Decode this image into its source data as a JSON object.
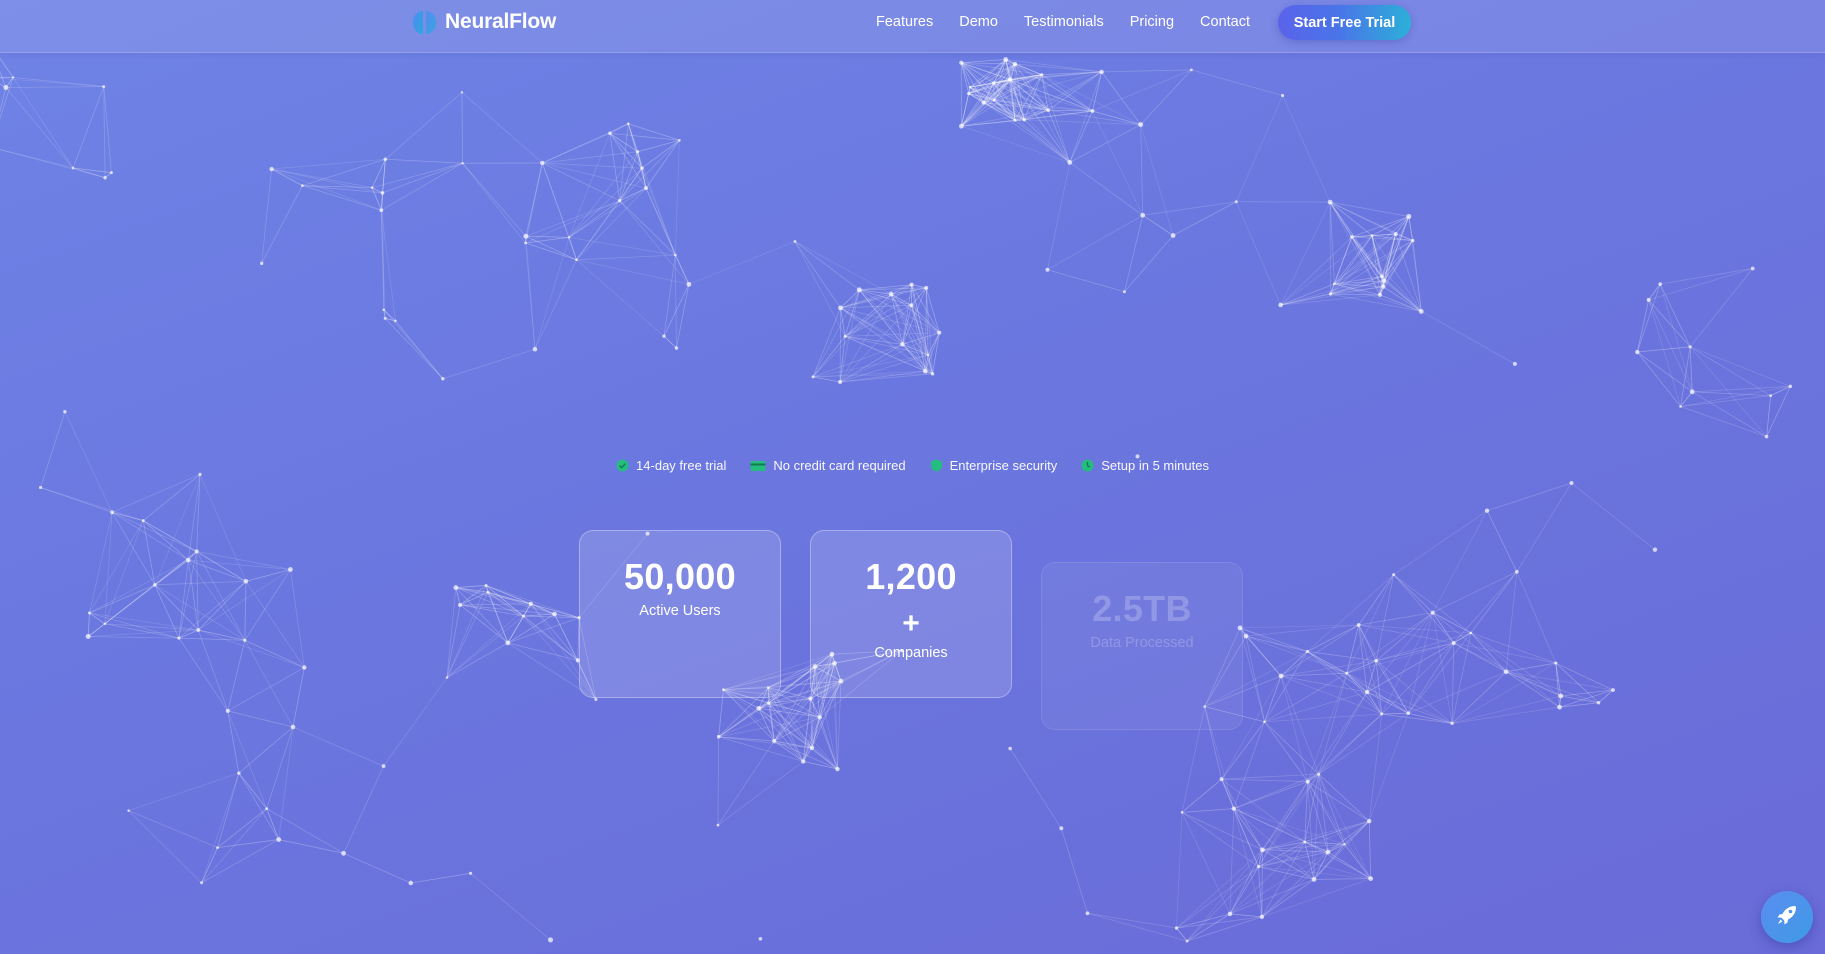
{
  "brand": {
    "name": "NeuralFlow",
    "logo_icon": "brain-icon"
  },
  "nav": {
    "links": [
      "Features",
      "Demo",
      "Testimonials",
      "Pricing",
      "Contact"
    ],
    "cta_label": "Start Free Trial"
  },
  "hero": {
    "features": [
      {
        "icon": "check-circle-icon",
        "label": "14-day free trial"
      },
      {
        "icon": "credit-card-icon",
        "label": "No credit card required"
      },
      {
        "icon": "shield-icon",
        "label": "Enterprise security"
      },
      {
        "icon": "clock-icon",
        "label": "Setup in 5 minutes"
      }
    ],
    "stats": [
      {
        "number": "50,000",
        "suffix": "",
        "label": "Active Users"
      },
      {
        "number": "1,200",
        "suffix": "+",
        "label": "Companies"
      },
      {
        "number": "2.5TB",
        "suffix": "",
        "label": "Data Processed"
      }
    ]
  },
  "floating_button": {
    "icon": "rocket-icon"
  },
  "colors": {
    "background_start": "#6f83e6",
    "background_end": "#6a6bd8",
    "accent_green": "#22c07a",
    "cta_gradient_start": "#5a63ea",
    "cta_gradient_end": "#2bb0d8"
  }
}
